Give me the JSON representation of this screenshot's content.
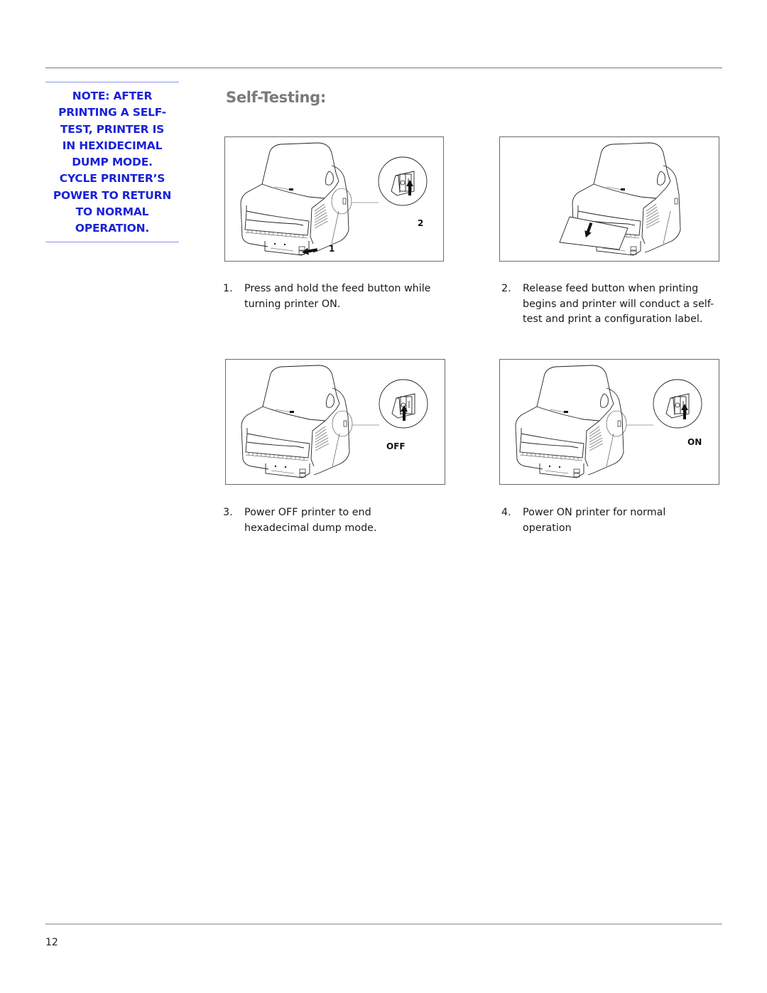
{
  "page": {
    "title": "Self-Testing:",
    "page_number": "12"
  },
  "note": {
    "lines": [
      "NOTE: AFTER",
      "PRINTING A SELF-",
      "TEST, PRINTER IS",
      "IN HEXIDECIMAL",
      "DUMP MODE.",
      "CYCLE PRINTER’S",
      "POWER TO RETURN",
      "TO NORMAL",
      "OPERATION."
    ],
    "color": "#1a22d8",
    "rule_color": "#8b93e8"
  },
  "figures": [
    {
      "name": "press-feed-and-power-on",
      "icon": "printer-illustration",
      "callouts": [
        "1",
        "2"
      ],
      "switch_state": "on"
    },
    {
      "name": "release-feed-label-printing",
      "icon": "printer-illustration-label-out",
      "callouts": [],
      "switch_state": null
    },
    {
      "name": "power-off",
      "icon": "printer-illustration",
      "callouts": [
        "OFF"
      ],
      "switch_state": "off"
    },
    {
      "name": "power-on",
      "icon": "printer-illustration",
      "callouts": [
        "ON"
      ],
      "switch_state": "on"
    }
  ],
  "steps": [
    {
      "number": "1.",
      "lines": [
        "Press and hold the feed button while",
        "turning printer ON."
      ]
    },
    {
      "number": "2.",
      "lines": [
        "Release feed button when printing",
        "begins and printer will conduct a self-",
        "test and print a configuration label."
      ]
    },
    {
      "number": "3.",
      "lines": [
        "Power OFF printer to end",
        "hexadecimal dump mode."
      ]
    },
    {
      "number": "4.",
      "lines": [
        "Power ON printer for normal",
        "operation"
      ]
    }
  ]
}
